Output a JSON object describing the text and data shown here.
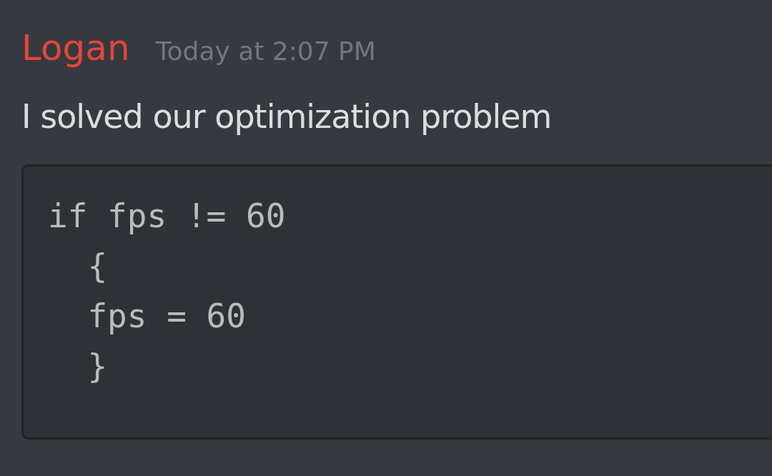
{
  "message": {
    "author": "Logan",
    "timestamp": "Today at 2:07 PM",
    "text": "I solved our optimization problem",
    "code_lines": [
      "if fps != 60",
      "  {",
      "  fps = 60",
      "  }"
    ]
  }
}
